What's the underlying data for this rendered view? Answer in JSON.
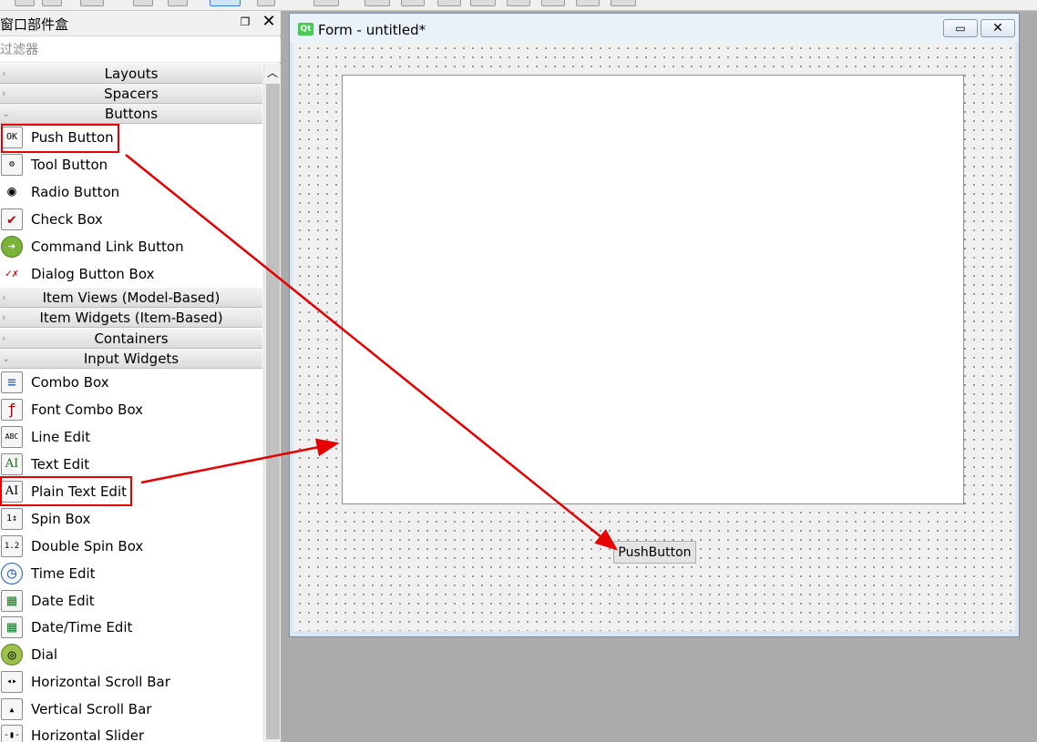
{
  "widget_box": {
    "title": "窗口部件盒",
    "float_icon": "restore-icon",
    "close_icon": "close-icon",
    "filter_placeholder": "过滤器",
    "categories": {
      "layouts": "Layouts",
      "spacers": "Spacers",
      "buttons": "Buttons",
      "item_views": "Item Views (Model-Based)",
      "item_widgets": "Item Widgets (Item-Based)",
      "containers": "Containers",
      "input_widgets": "Input Widgets"
    },
    "buttons_items": [
      {
        "label": "Push Button",
        "icon": "push-button-icon",
        "glyph": "OK"
      },
      {
        "label": "Tool Button",
        "icon": "tool-button-icon",
        "glyph": "⚙"
      },
      {
        "label": "Radio Button",
        "icon": "radio-button-icon",
        "glyph": "◉"
      },
      {
        "label": "Check Box",
        "icon": "check-box-icon",
        "glyph": "✔"
      },
      {
        "label": "Command Link Button",
        "icon": "command-link-icon",
        "glyph": "➔"
      },
      {
        "label": "Dialog Button Box",
        "icon": "dialog-button-box-icon",
        "glyph": "✓✗"
      }
    ],
    "input_items": [
      {
        "label": "Combo Box",
        "icon": "combo-box-icon",
        "glyph": "≡"
      },
      {
        "label": "Font Combo Box",
        "icon": "font-combo-box-icon",
        "glyph": "ƒ"
      },
      {
        "label": "Line Edit",
        "icon": "line-edit-icon",
        "glyph": "ABC"
      },
      {
        "label": "Text Edit",
        "icon": "text-edit-icon",
        "glyph": "AI"
      },
      {
        "label": "Plain Text Edit",
        "icon": "plain-text-edit-icon",
        "glyph": "AI"
      },
      {
        "label": "Spin Box",
        "icon": "spin-box-icon",
        "glyph": "1↕"
      },
      {
        "label": "Double Spin Box",
        "icon": "double-spin-box-icon",
        "glyph": "1.2"
      },
      {
        "label": "Time Edit",
        "icon": "clock-icon",
        "glyph": "◷"
      },
      {
        "label": "Date Edit",
        "icon": "calendar-icon",
        "glyph": "▦"
      },
      {
        "label": "Date/Time Edit",
        "icon": "date-time-icon",
        "glyph": "▦"
      },
      {
        "label": "Dial",
        "icon": "dial-icon",
        "glyph": "◎"
      },
      {
        "label": "Horizontal Scroll Bar",
        "icon": "horizontal-scroll-bar-icon",
        "glyph": "◂▸"
      },
      {
        "label": "Vertical Scroll Bar",
        "icon": "vertical-scroll-bar-icon",
        "glyph": "▴"
      },
      {
        "label": "Horizontal Slider",
        "icon": "horizontal-slider-icon",
        "glyph": "-▮-"
      }
    ]
  },
  "form_window": {
    "title": "Form - untitled*",
    "app_icon_text": "Qt",
    "minimize_icon": "minimize-icon",
    "close_icon": "close-icon",
    "push_button_text": "PushButton"
  },
  "colors": {
    "highlight": "#e60000",
    "canvas": "#f0f0f0",
    "workspace": "#ababab"
  }
}
